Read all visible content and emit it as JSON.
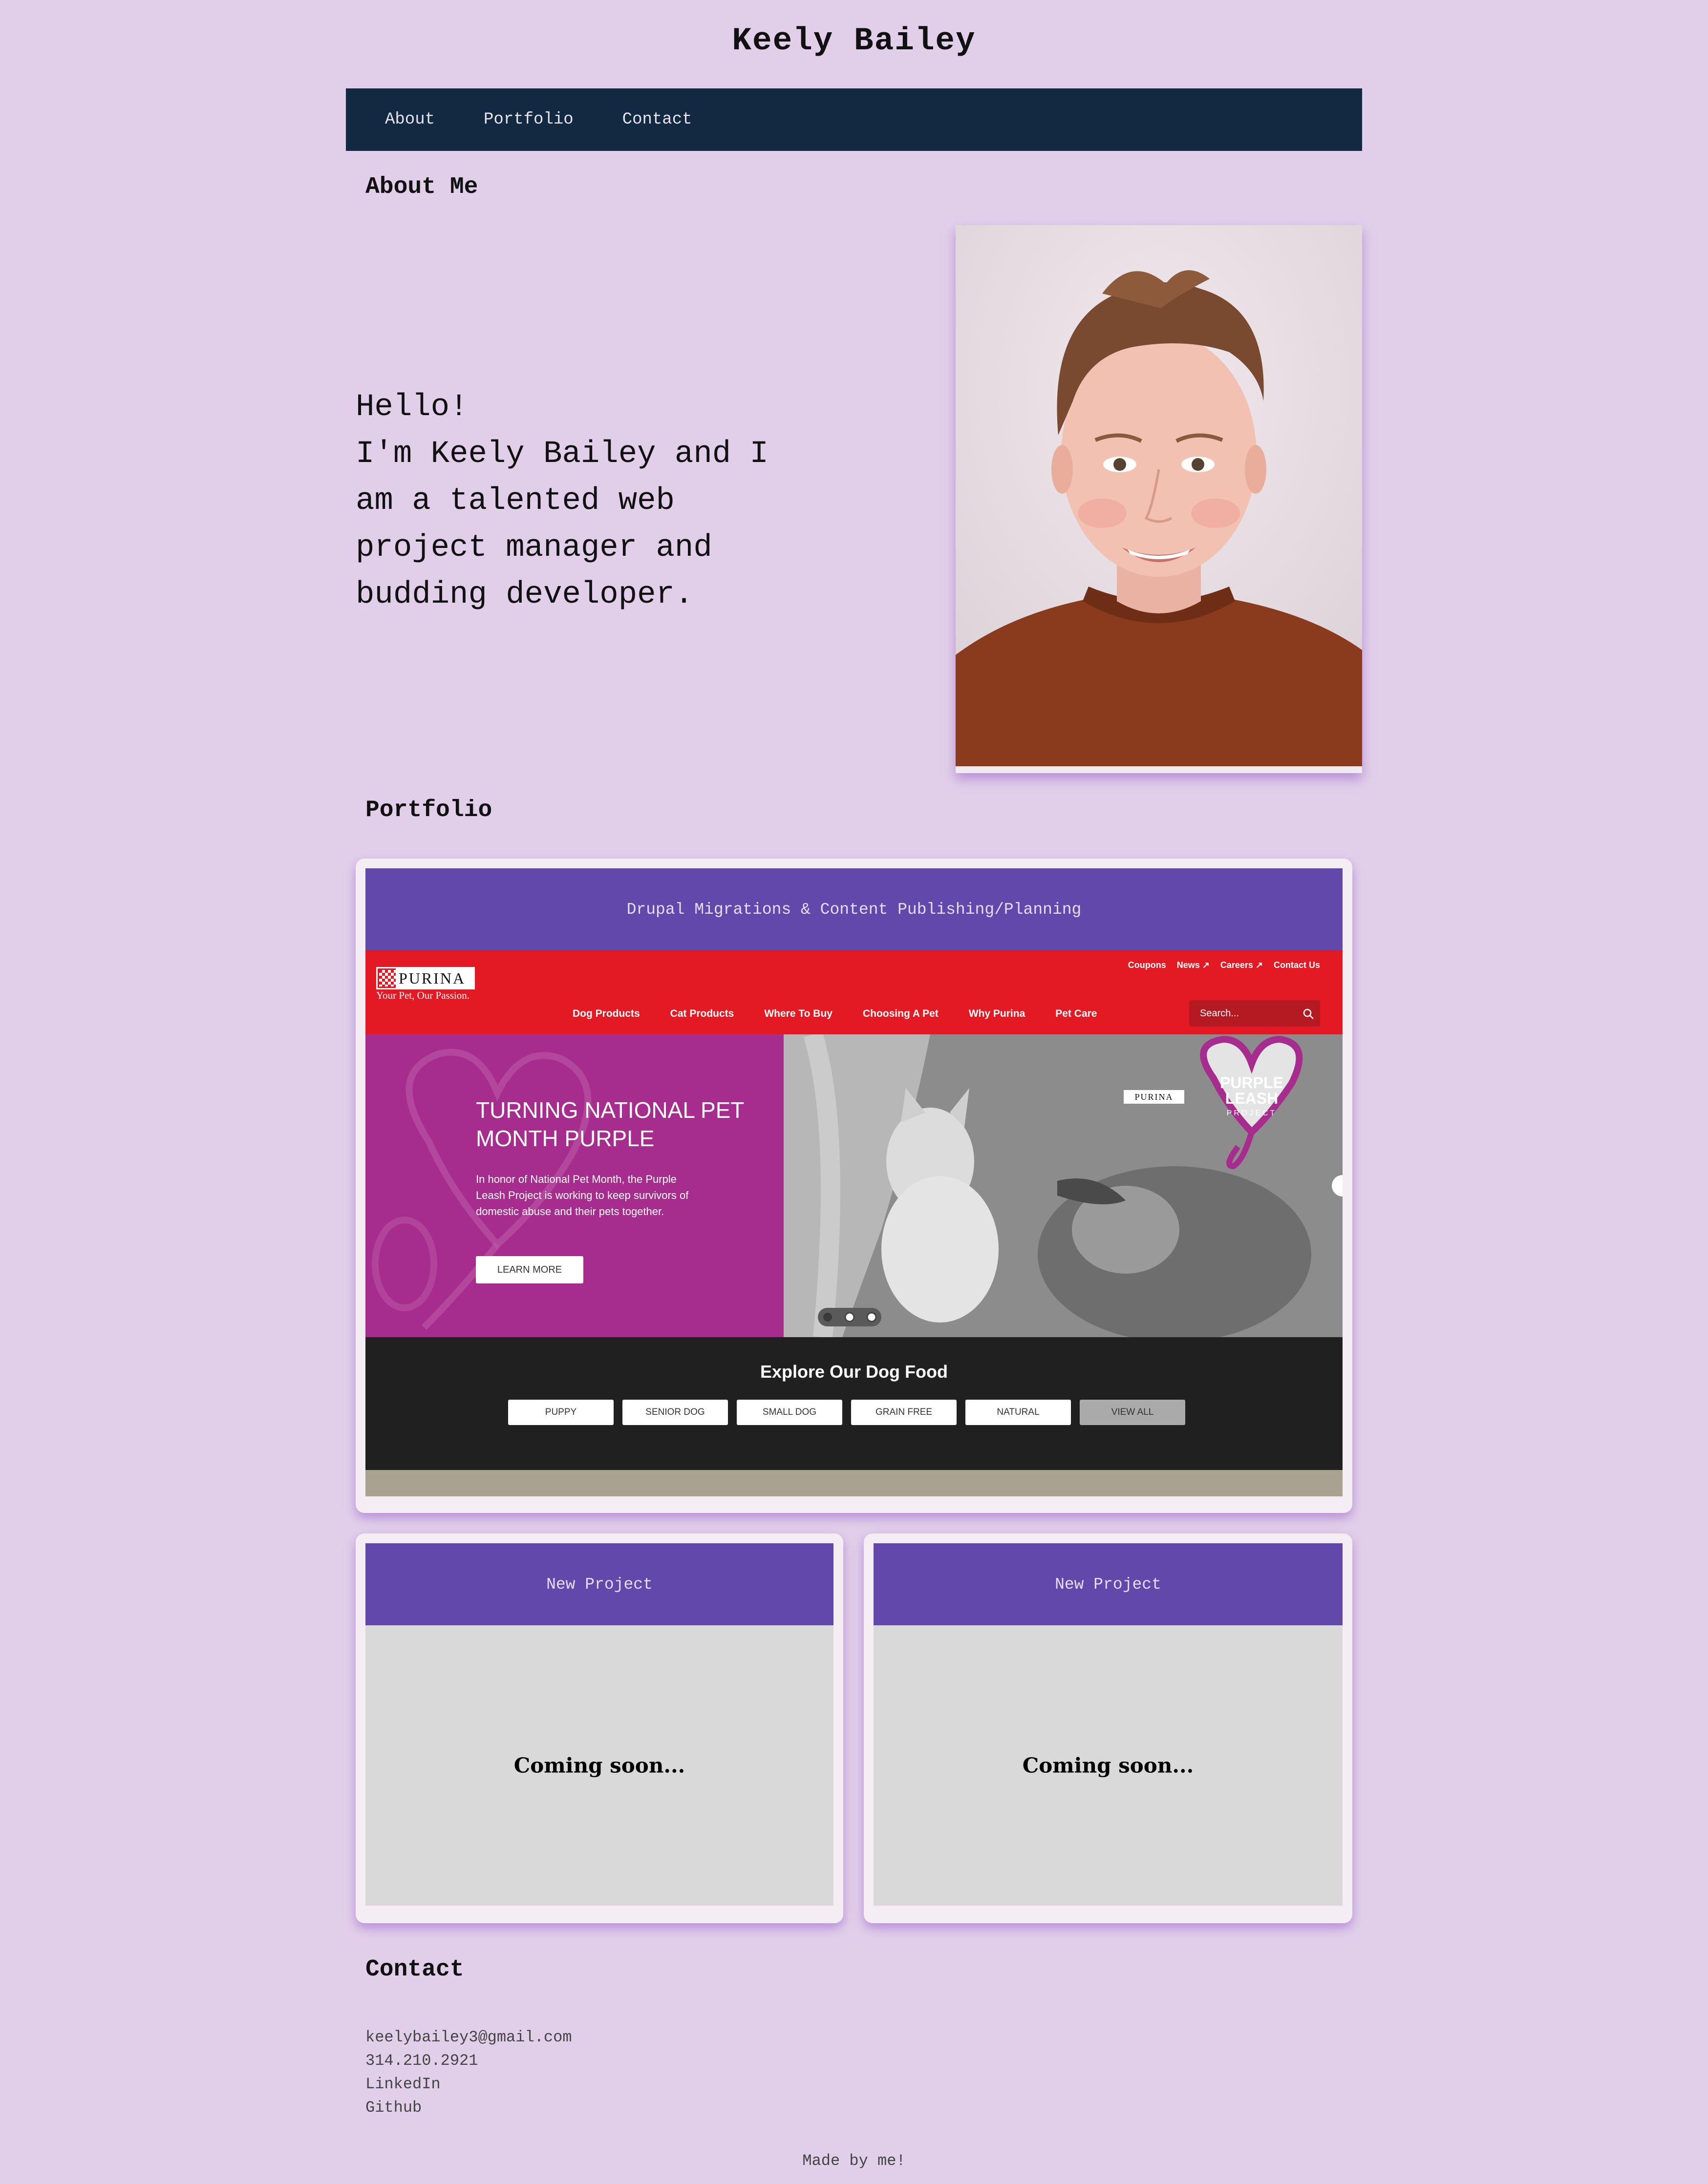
{
  "site": {
    "title": "Keely Bailey"
  },
  "nav": {
    "items": [
      {
        "label": "About"
      },
      {
        "label": "Portfolio"
      },
      {
        "label": "Contact"
      }
    ]
  },
  "about": {
    "heading": "About Me",
    "intro_lines": [
      "Hello!",
      "I'm Keely Bailey and I",
      "am a talented web",
      "project manager and",
      "budding developer."
    ]
  },
  "portfolio": {
    "heading": "Portfolio",
    "featured": {
      "title": "Drupal Migrations & Content Publishing/Planning",
      "screenshot": {
        "brand": "PURINA",
        "tagline": "Your Pet, Our Passion.",
        "utility_links": [
          "Coupons",
          "News ↗",
          "Careers ↗",
          "Contact Us"
        ],
        "menu": [
          "Dog Products",
          "Cat Products",
          "Where To Buy",
          "Choosing A Pet",
          "Why Purina",
          "Pet Care"
        ],
        "search_placeholder": "Search...",
        "hero_heading": "TURNING NATIONAL PET MONTH PURPLE",
        "hero_copy": "In honor of National Pet Month, the Purple Leash Project is working to keep survivors of domestic abuse and their pets together.",
        "hero_button": "LEARN MORE",
        "badge_line1": "PURPLE",
        "badge_line2": "LEASH",
        "badge_line3": "PROJECT",
        "badge_brand": "PURINA",
        "dog_food_heading": "Explore Our Dog Food",
        "dog_food_chips": [
          "PUPPY",
          "SENIOR DOG",
          "SMALL DOG",
          "GRAIN FREE",
          "NATURAL",
          "VIEW ALL"
        ]
      }
    },
    "projects": [
      {
        "title": "New Project",
        "status": "Coming soon..."
      },
      {
        "title": "New Project",
        "status": "Coming soon..."
      }
    ]
  },
  "contact": {
    "heading": "Contact",
    "email": "keelybailey3@gmail.com",
    "phone": "314.210.2921",
    "linkedin": "LinkedIn",
    "github": "Github"
  },
  "footer": {
    "note": "Made by me!"
  },
  "colors": {
    "background": "#e1cfea",
    "nav": "#122a41",
    "card_header": "#6248ab",
    "purina_red": "#e31a23",
    "purina_purple": "#a62c8e"
  }
}
